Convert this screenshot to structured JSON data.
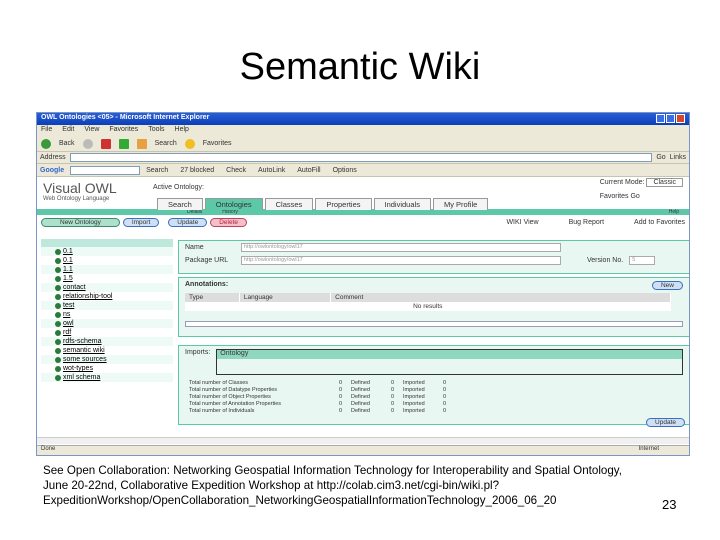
{
  "slide": {
    "title": "Semantic Wiki",
    "caption": "See Open Collaboration: Networking Geospatial Information Technology for Interoperability and Spatial Ontology, June 20-22nd, Collaborative Expedition Workshop at http://colab.cim3.net/cgi-bin/wiki.pl?ExpeditionWorkshop/OpenCollaboration_NetworkingGeospatialInformationTechnology_2006_06_20",
    "page_number": "23"
  },
  "browser": {
    "title": "OWL Ontologies <05> - Microsoft Internet Explorer",
    "menu": [
      "File",
      "Edit",
      "View",
      "Favorites",
      "Tools",
      "Help"
    ],
    "toolbar": [
      "Back",
      "Search",
      "Favorites"
    ],
    "address_label": "Address",
    "go": "Go",
    "links": "Links",
    "google": "Google",
    "google_items": [
      "Search",
      "27 blocked",
      "Check",
      "AutoLink",
      "AutoFill",
      "Options"
    ],
    "status": "Done",
    "zone": "Internet"
  },
  "app": {
    "logo": "Visual OWL",
    "logo_sub": "Web Ontology Language",
    "active_ontology": "Active Ontology:",
    "current_mode_label": "Current Mode:",
    "current_mode": "Classic",
    "favorites": "Favorites",
    "go": "Go",
    "tabs": [
      "Search",
      "Ontologies",
      "Classes",
      "Properties",
      "Individuals",
      "My Profile"
    ],
    "subtabs": [
      "Details",
      "History"
    ],
    "help": "Help",
    "buttons": {
      "new_ontology": "New Ontology",
      "import": "Import",
      "update": "Update",
      "delete": "Delete",
      "new": "New",
      "update_bottom": "Update"
    },
    "links": [
      "WIKI View",
      "Bug Report",
      "Add to Favorites"
    ],
    "tree": [
      "0.1",
      "0.1",
      "1.1",
      "1.5",
      "contact",
      "relationship-tool",
      "test",
      "ns",
      "owl",
      "rdf",
      "rdfs-schema",
      "semantic wiki",
      "some sources",
      "wot-types",
      "xml schema"
    ],
    "form": {
      "name_label": "Name",
      "name_value": "http://owlontology/owl17",
      "url_label": "Package URL",
      "url_value": "http://owlontology/owl17",
      "version_label": "Version No.",
      "version_value": "5"
    },
    "annotations": {
      "title": "Annotations:",
      "columns": [
        "Type",
        "Language",
        "Comment"
      ],
      "empty": "No results"
    },
    "imports": {
      "label": "Imports:",
      "item": "Ontology"
    },
    "stats": [
      [
        "Total number of Classes",
        "0",
        "Defined",
        "0",
        "Imported",
        "0"
      ],
      [
        "Total number of Datatype Properties",
        "0",
        "Defined",
        "0",
        "Imported",
        "0"
      ],
      [
        "Total number of Object Properties",
        "0",
        "Defined",
        "0",
        "Imported",
        "0"
      ],
      [
        "Total number of Annotation Properties",
        "0",
        "Defined",
        "0",
        "Imported",
        "0"
      ],
      [
        "Total number of Individuals",
        "0",
        "Defined",
        "0",
        "Imported",
        "0"
      ]
    ]
  }
}
